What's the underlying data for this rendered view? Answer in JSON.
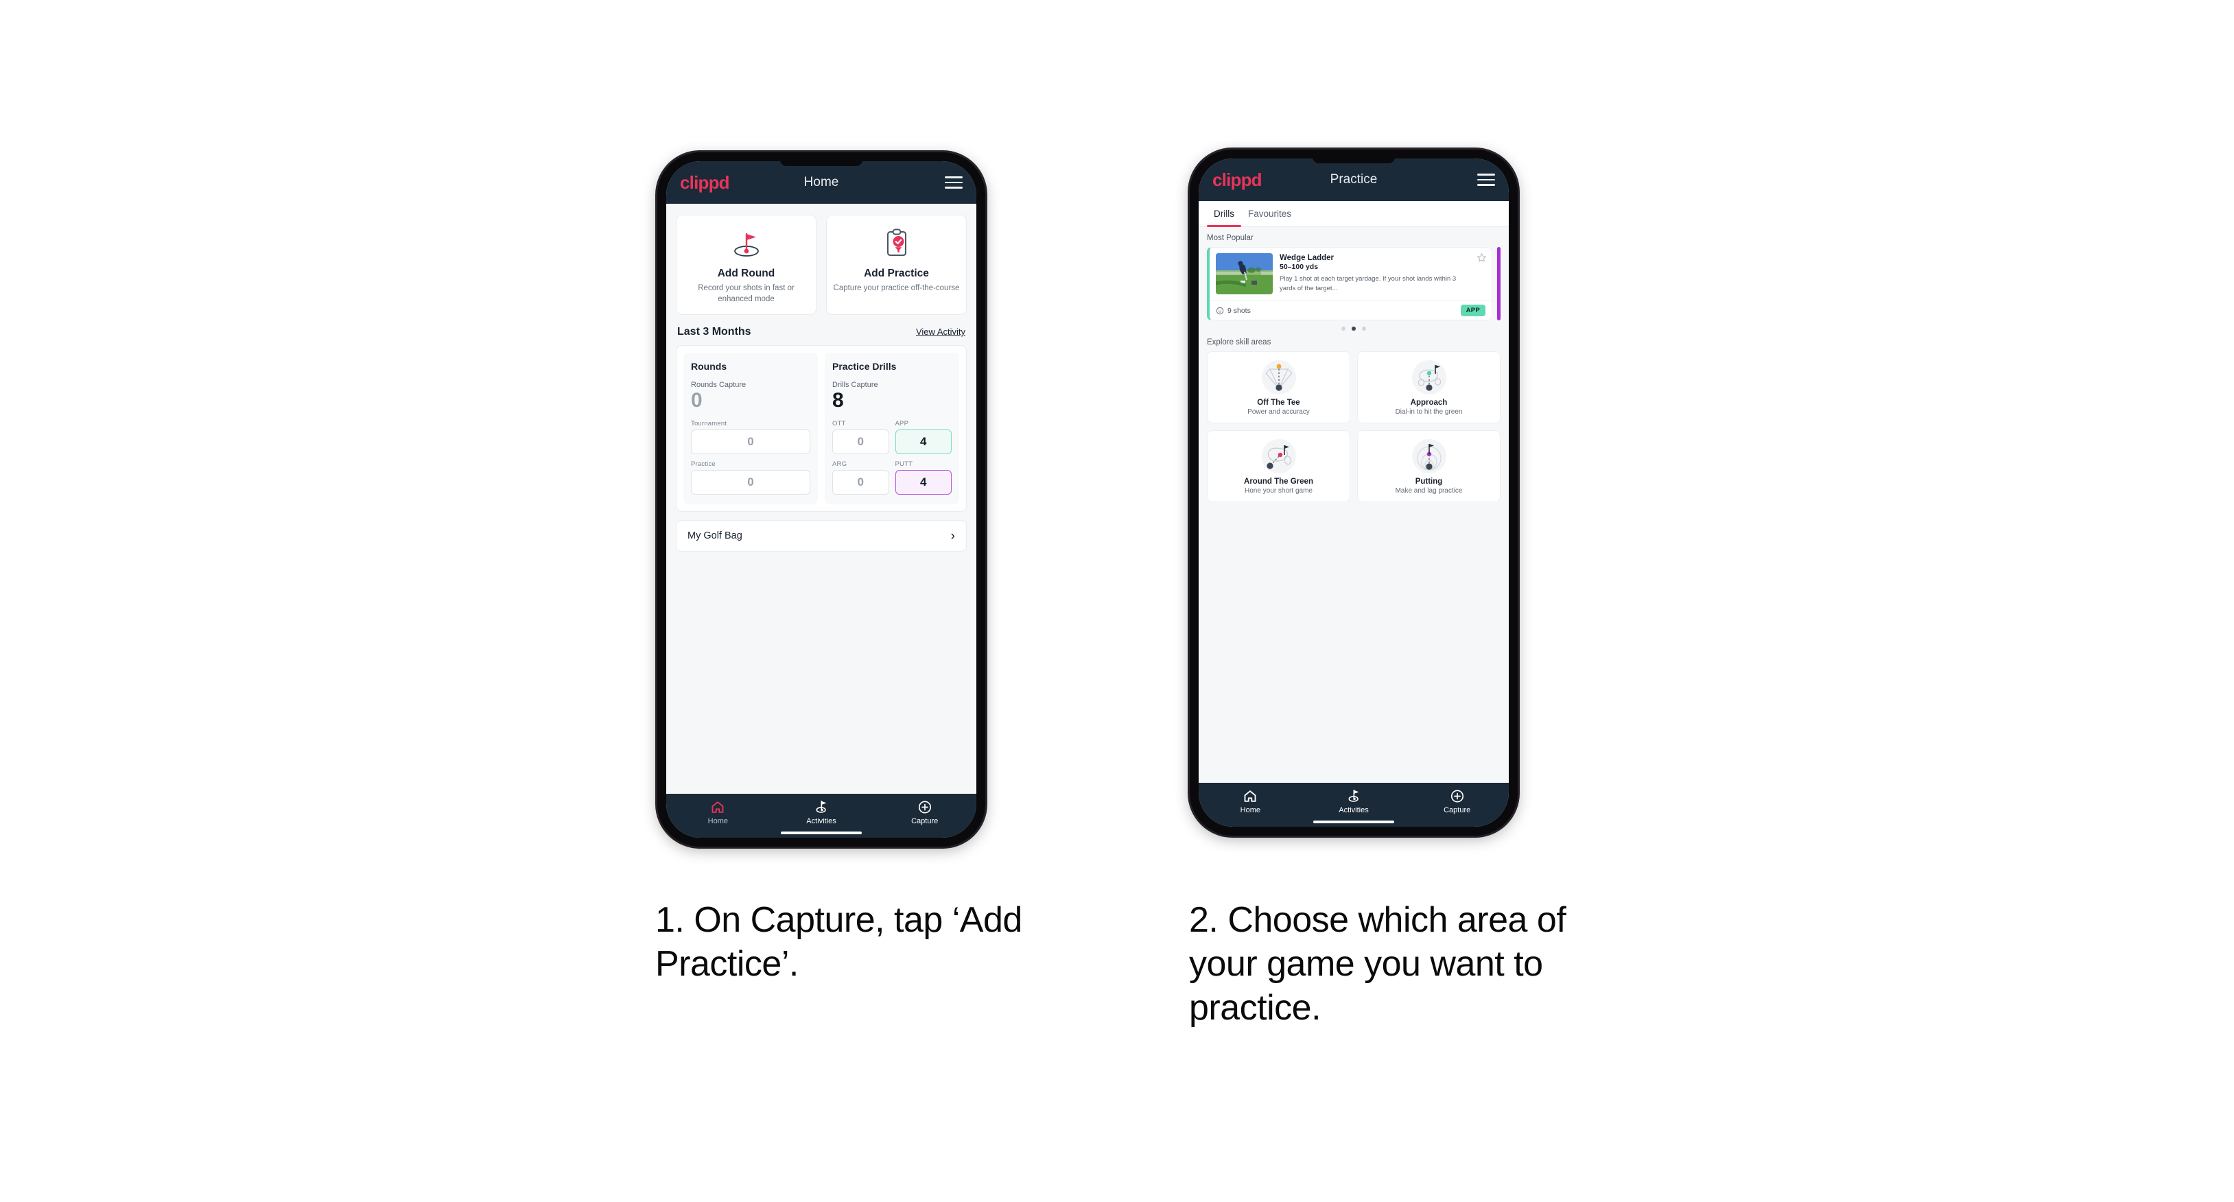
{
  "theme": {
    "brand_pink": "#e8345a",
    "header_navy": "#1b2a38",
    "accent_green": "#5fd9b1",
    "accent_purple": "#a82ed4",
    "page_bg": "#ffffff"
  },
  "phone1": {
    "header": {
      "logo": "clippd",
      "title": "Home",
      "menu_icon": "hamburger-icon"
    },
    "action_cards": [
      {
        "icon": "golf-flag-hole-icon",
        "title": "Add Round",
        "subtitle": "Record your shots in fast or enhanced mode"
      },
      {
        "icon": "clipboard-check-icon",
        "title": "Add Practice",
        "subtitle": "Capture your practice off-the-course"
      }
    ],
    "section": {
      "title": "Last 3 Months",
      "link": "View Activity"
    },
    "stats": {
      "rounds": {
        "heading": "Rounds",
        "capture_label": "Rounds Capture",
        "capture_value": "0",
        "fields": [
          {
            "label": "Tournament",
            "value": "0",
            "state": "empty"
          },
          {
            "label": "Practice",
            "value": "0",
            "state": "empty"
          }
        ]
      },
      "drills": {
        "heading": "Practice Drills",
        "capture_label": "Drills Capture",
        "capture_value": "8",
        "fields": [
          {
            "label": "OTT",
            "value": "0",
            "state": "empty"
          },
          {
            "label": "APP",
            "value": "4",
            "state": "green"
          },
          {
            "label": "ARG",
            "value": "0",
            "state": "empty"
          },
          {
            "label": "PUTT",
            "value": "4",
            "state": "purple"
          }
        ]
      }
    },
    "golf_bag": {
      "label": "My Golf Bag",
      "chevron": "chevron-right-icon"
    },
    "bottom_nav": [
      {
        "icon": "home-icon",
        "label": "Home",
        "active": true
      },
      {
        "icon": "golf-flag-icon",
        "label": "Activities",
        "active": false
      },
      {
        "icon": "plus-circle-icon",
        "label": "Capture",
        "active": false
      }
    ]
  },
  "phone2": {
    "header": {
      "logo": "clippd",
      "title": "Practice",
      "menu_icon": "hamburger-icon"
    },
    "tabs": [
      {
        "label": "Drills",
        "active": true
      },
      {
        "label": "Favourites",
        "active": false
      }
    ],
    "most_popular_label": "Most Popular",
    "drill_card": {
      "thumbnail": "golfer-chipping-photo",
      "name": "Wedge Ladder",
      "yardage": "50–100 yds",
      "description": "Play 1 shot at each target yardage. If your shot lands within 3 yards of the target...",
      "favourite_icon": "star-outline-icon",
      "shots_icon": "clock-icon",
      "shots": "9 shots",
      "badge": "APP"
    },
    "carousel_dots": {
      "count": 3,
      "active_index": 1
    },
    "skill_label": "Explore skill areas",
    "skill_areas": [
      {
        "icon": "off-the-tee-icon",
        "name": "Off The Tee",
        "subtitle": "Power and accuracy"
      },
      {
        "icon": "approach-icon",
        "name": "Approach",
        "subtitle": "Dial-in to hit the green"
      },
      {
        "icon": "around-the-green-icon",
        "name": "Around The Green",
        "subtitle": "Hone your short game"
      },
      {
        "icon": "putting-icon",
        "name": "Putting",
        "subtitle": "Make and lag practice"
      }
    ],
    "bottom_nav": [
      {
        "icon": "home-icon",
        "label": "Home",
        "active": false
      },
      {
        "icon": "golf-flag-icon",
        "label": "Activities",
        "active": false
      },
      {
        "icon": "plus-circle-icon",
        "label": "Capture",
        "active": false
      }
    ]
  },
  "captions": {
    "step1": "1. On Capture, tap ‘Add Practice’.",
    "step2": "2. Choose which area of your game you want to practice."
  }
}
